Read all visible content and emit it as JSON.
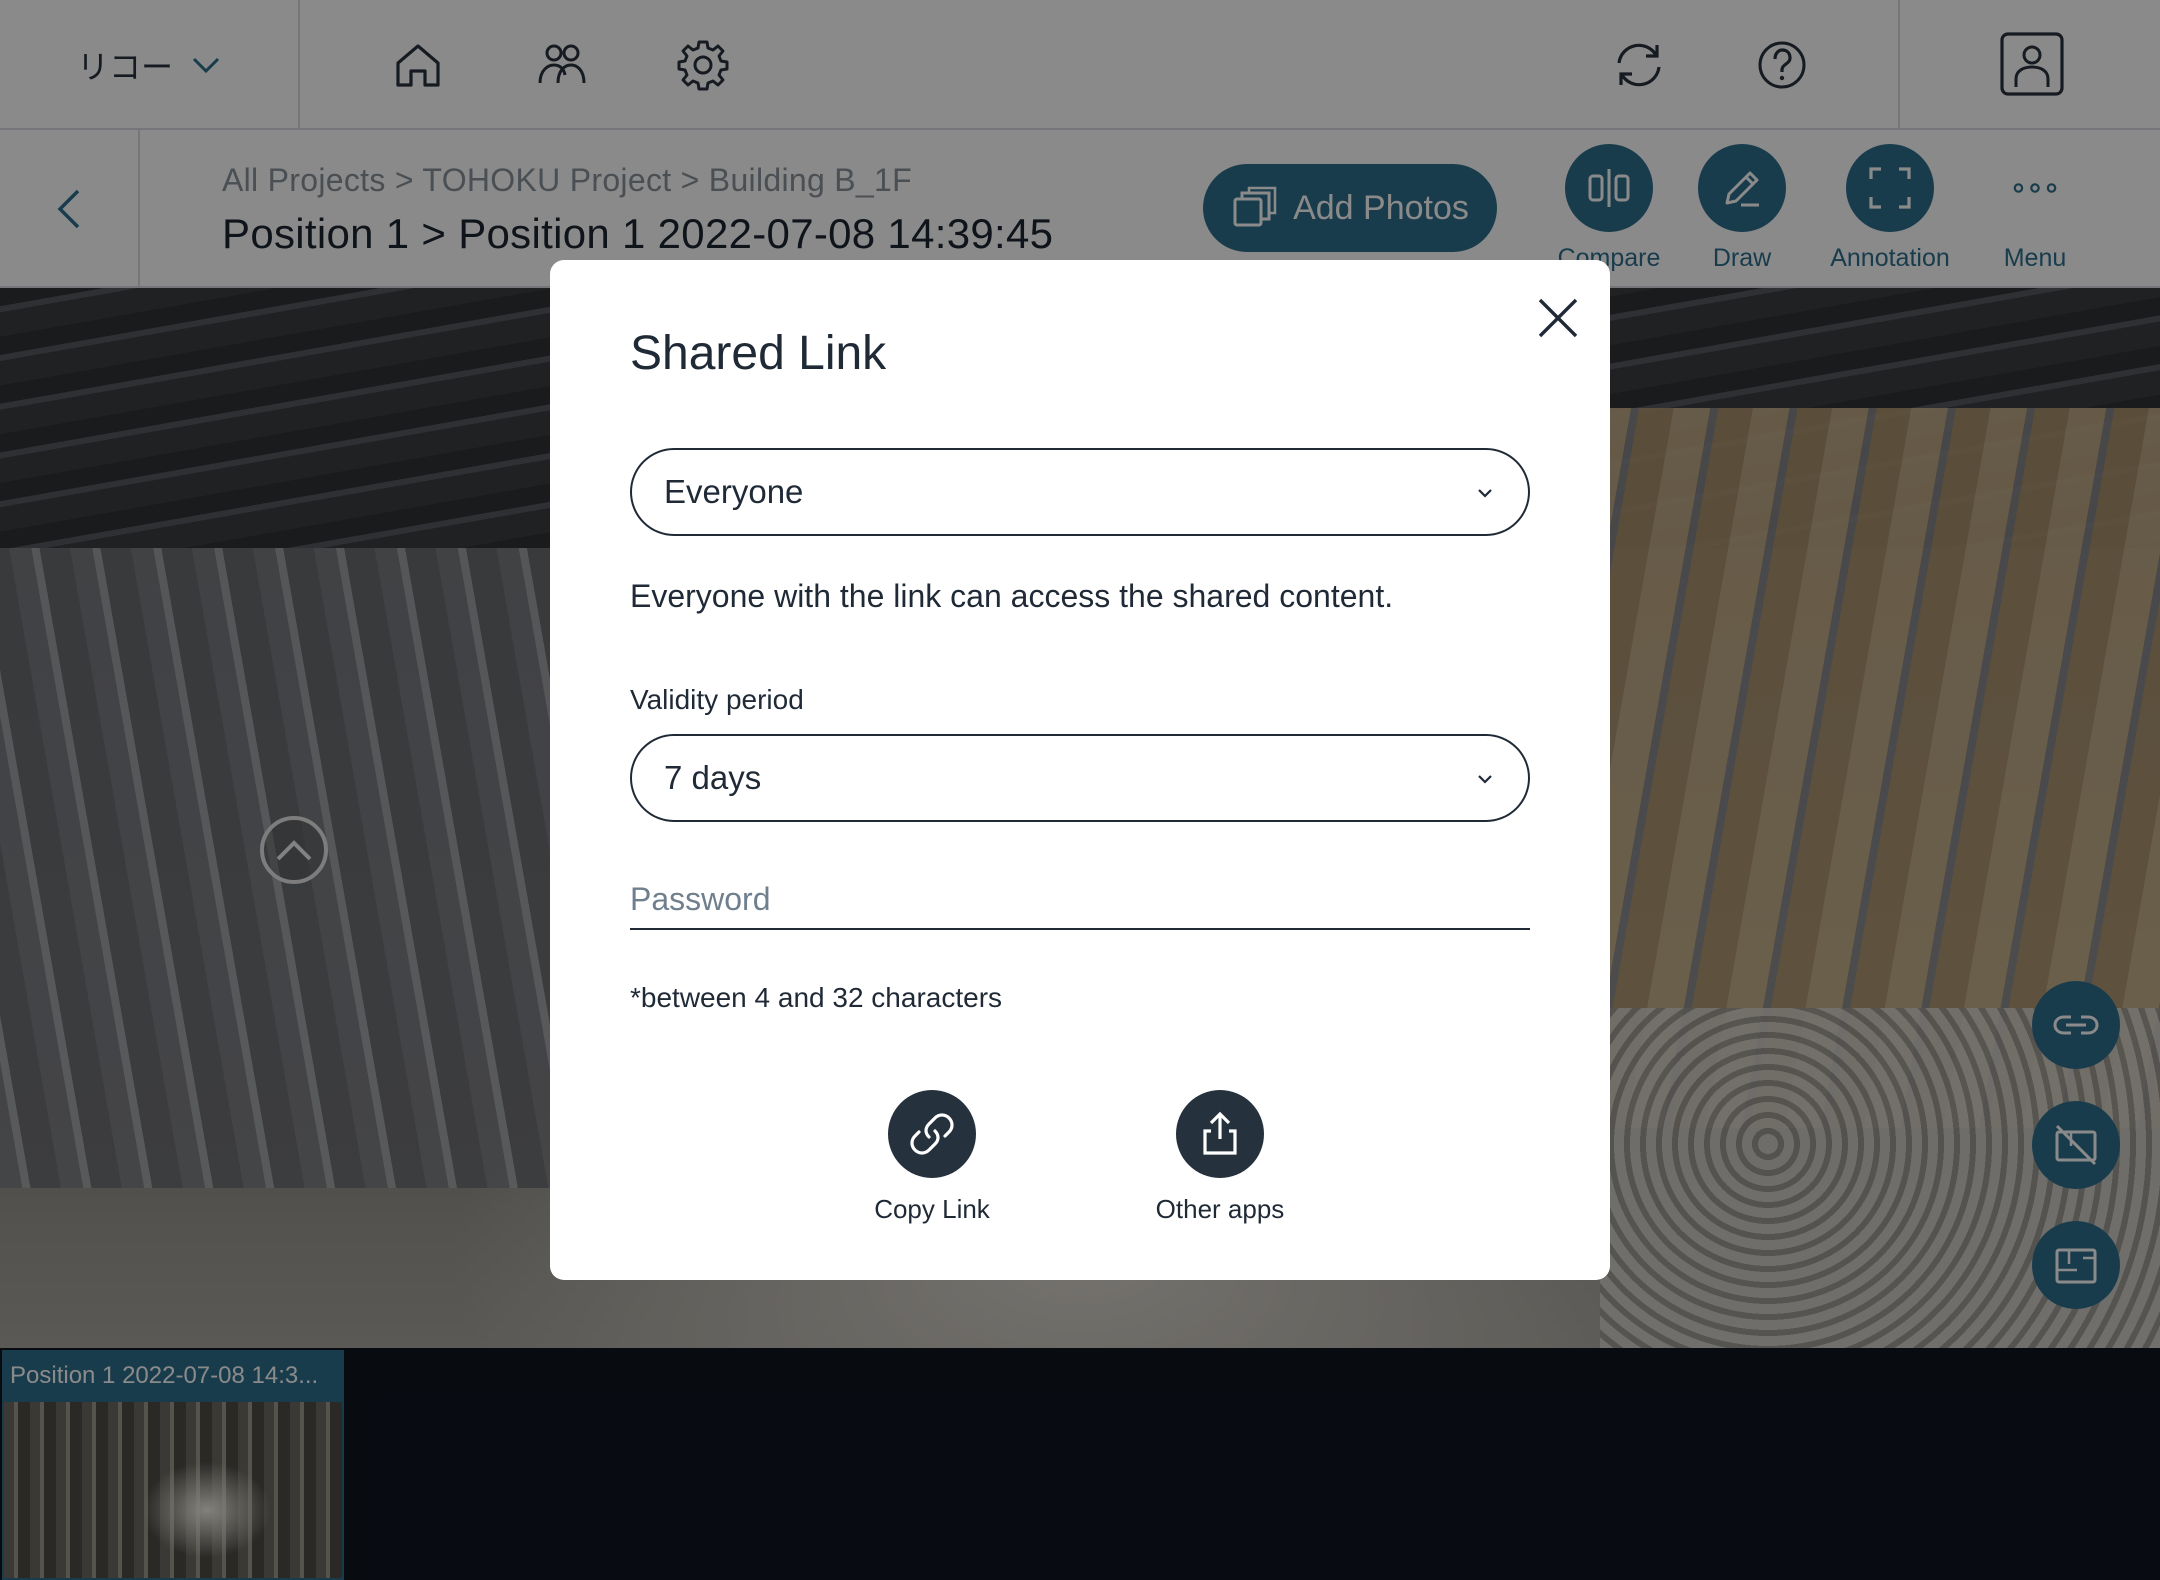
{
  "header": {
    "org_name": "リコー",
    "icons": [
      "home-icon",
      "users-icon",
      "gear-icon",
      "sync-icon",
      "help-icon",
      "account-icon"
    ]
  },
  "subheader": {
    "breadcrumb": "All Projects > TOHOKU Project > Building B_1F",
    "title": "Position 1 > Position 1 2022-07-08 14:39:45",
    "add_photos_label": "Add Photos",
    "tools": [
      {
        "label": "Compare",
        "icon": "compare-icon"
      },
      {
        "label": "Draw",
        "icon": "pencil-icon"
      },
      {
        "label": "Annotation",
        "icon": "frame-icon"
      },
      {
        "label": "Menu",
        "icon": "more-icon"
      }
    ]
  },
  "filmstrip": {
    "items": [
      {
        "caption": "Position 1 2022-07-08 14:3..."
      }
    ]
  },
  "modal": {
    "title": "Shared Link",
    "audience": {
      "selected": "Everyone"
    },
    "description": "Everyone with the link can access the shared content.",
    "validity": {
      "label": "Validity period",
      "selected": "7 days"
    },
    "password": {
      "placeholder": "Password",
      "value": ""
    },
    "hint": "*between 4 and 32 characters",
    "actions": [
      {
        "label": "Copy Link",
        "icon": "link-icon"
      },
      {
        "label": "Other apps",
        "icon": "share-icon"
      }
    ]
  },
  "colors": {
    "accent": "#2f6f8f",
    "dark_button": "#25313d"
  }
}
